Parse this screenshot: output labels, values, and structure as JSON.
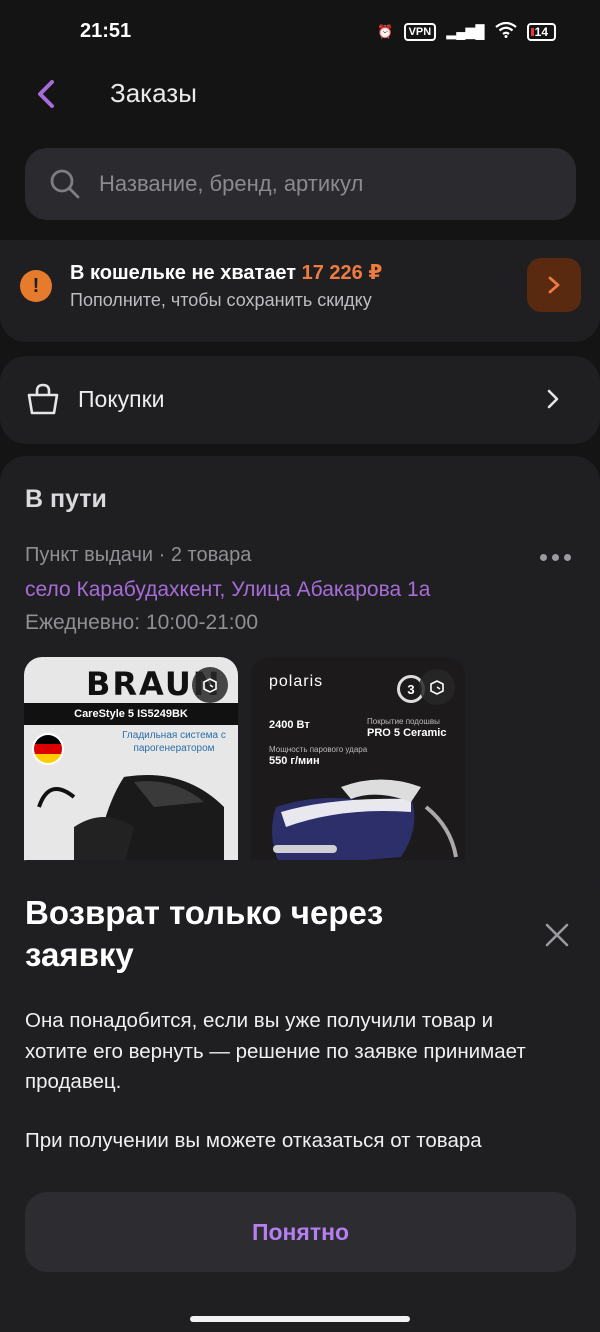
{
  "status_bar": {
    "time": "21:51",
    "vpn": "VPN",
    "battery": "14"
  },
  "header": {
    "title": "Заказы"
  },
  "search": {
    "placeholder": "Название, бренд, артикул"
  },
  "wallet": {
    "message": "В кошельке не хватает",
    "amount": "17 226 ₽",
    "subtitle": "Пополните, чтобы сохранить скидку",
    "accent": "#ef7c3f"
  },
  "purchases": {
    "label": "Покупки"
  },
  "in_transit": {
    "title": "В пути",
    "pickup_info": "Пункт выдачи · 2 товара",
    "address": "село Карабудахкент, Улица Абакарова 1а",
    "hours": "Ежедневно: 10:00-21:00",
    "products": [
      {
        "brand": "BRAUN",
        "model": "CareStyle 5 IS5249BK",
        "caption": "Гладильная система с парогенератором"
      },
      {
        "brand": "polaris",
        "power": "2400 Вт",
        "coating_label": "Покрытие подошвы",
        "coating": "PRO 5 Ceramic",
        "steam_label": "Мощность парового удара",
        "steam": "550 г/мин"
      }
    ]
  },
  "sheet": {
    "title": "Возврат только через заявку",
    "body": "Она понадобится, если вы уже получили товар и хотите его вернуть — решение по заявке принимает продавец.",
    "body2": "При получении вы можете отказаться от товара",
    "button": "Понятно",
    "button_color": "#b57ff0"
  }
}
